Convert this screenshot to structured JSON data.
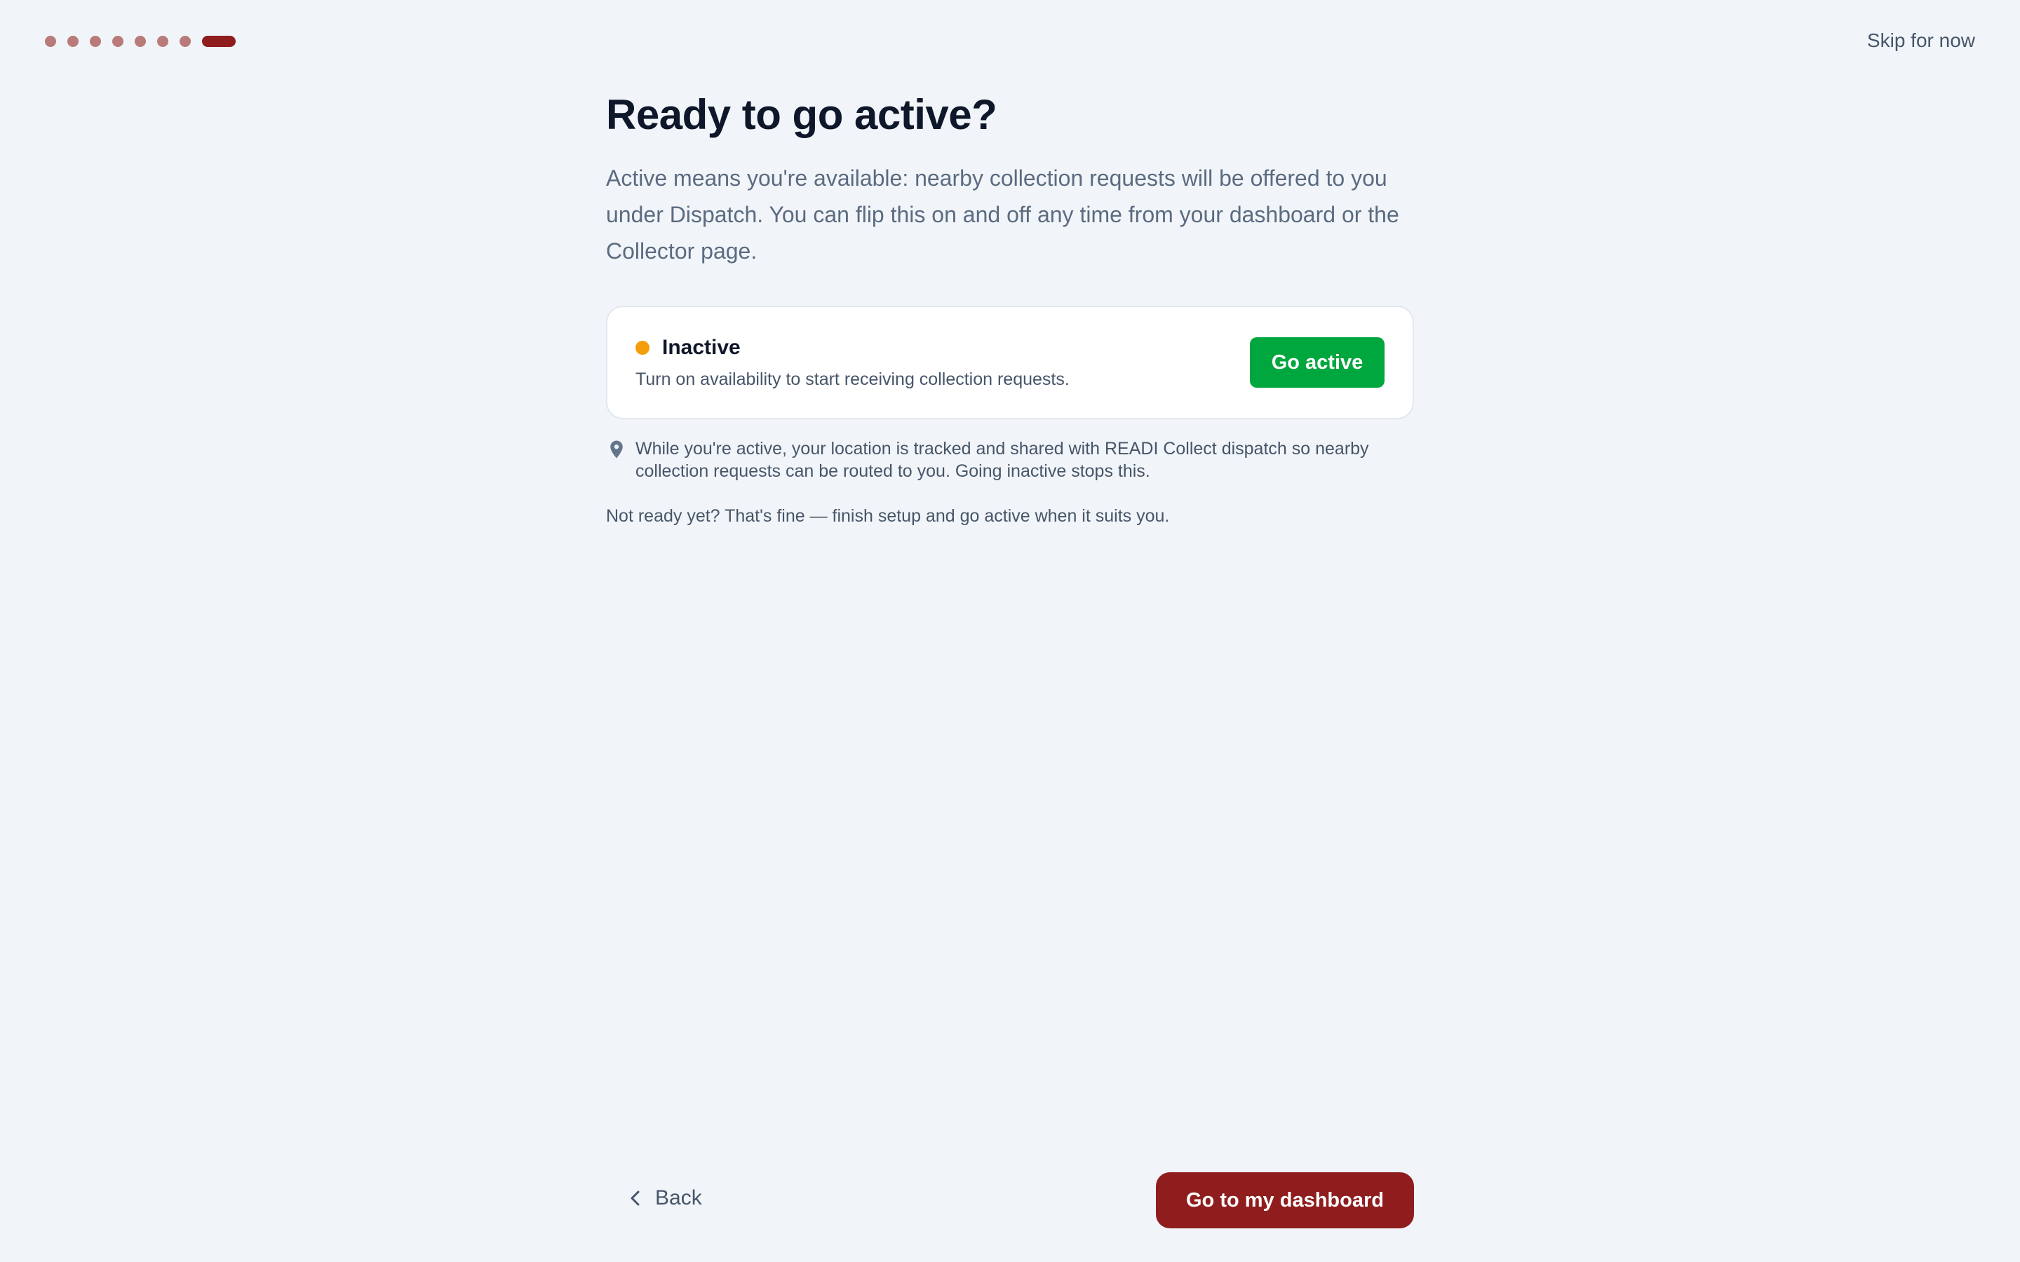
{
  "stepper": {
    "total_steps": 8,
    "current_step": 8,
    "completed_color": "#b97b79",
    "active_color": "#8f1d1d"
  },
  "header": {
    "skip_label": "Skip for now"
  },
  "main": {
    "title": "Ready to go active?",
    "intro": "Active means you're available: nearby collection requests will be offered to you under Dispatch. You can flip this on and off any time from your dashboard or the Collector page.",
    "status_card": {
      "status_label": "Inactive",
      "status_color": "#f59e0b",
      "description": "Turn on availability to start receiving collection requests.",
      "go_active_label": "Go active",
      "go_active_color": "#00a63e"
    },
    "location_note": {
      "icon": "map-pin-icon",
      "text": "While you're active, your location is tracked and shared with READI Collect dispatch so nearby collection requests can be routed to you. Going inactive stops this."
    },
    "not_ready_text": "Not ready yet? That's fine — finish setup and go active when it suits you."
  },
  "footer": {
    "back_label": "Back",
    "dashboard_label": "Go to my dashboard",
    "dashboard_color": "#8f1d1d"
  }
}
